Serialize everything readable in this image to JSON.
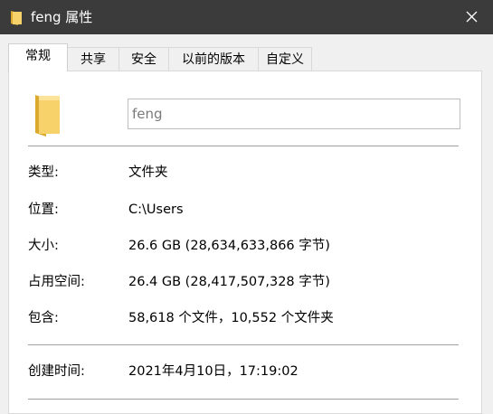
{
  "window": {
    "title": "feng 属性",
    "title_icon": "folder-icon",
    "close_icon": "close-icon"
  },
  "tabs": [
    {
      "label": "常规",
      "active": true
    },
    {
      "label": "共享",
      "active": false
    },
    {
      "label": "安全",
      "active": false
    },
    {
      "label": "以前的版本",
      "active": false
    },
    {
      "label": "自定义",
      "active": false
    }
  ],
  "general": {
    "folder_name": "feng",
    "type": {
      "label": "类型:",
      "value": "文件夹"
    },
    "location": {
      "label": "位置:",
      "value": "C:\\Users"
    },
    "size": {
      "label": "大小:",
      "value": "26.6 GB (28,634,633,866 字节)"
    },
    "size_on_disk": {
      "label": "占用空间:",
      "value": "26.4 GB (28,417,507,328 字节)"
    },
    "contains": {
      "label": "包含:",
      "value": "58,618 个文件，10,552 个文件夹"
    },
    "created": {
      "label": "创建时间:",
      "value": "2021年4月10日，17:19:02"
    }
  },
  "colors": {
    "titlebar_bg": "#3b3b3b",
    "folder_yellow": "#f7d26b",
    "folder_dark": "#dba92d"
  }
}
